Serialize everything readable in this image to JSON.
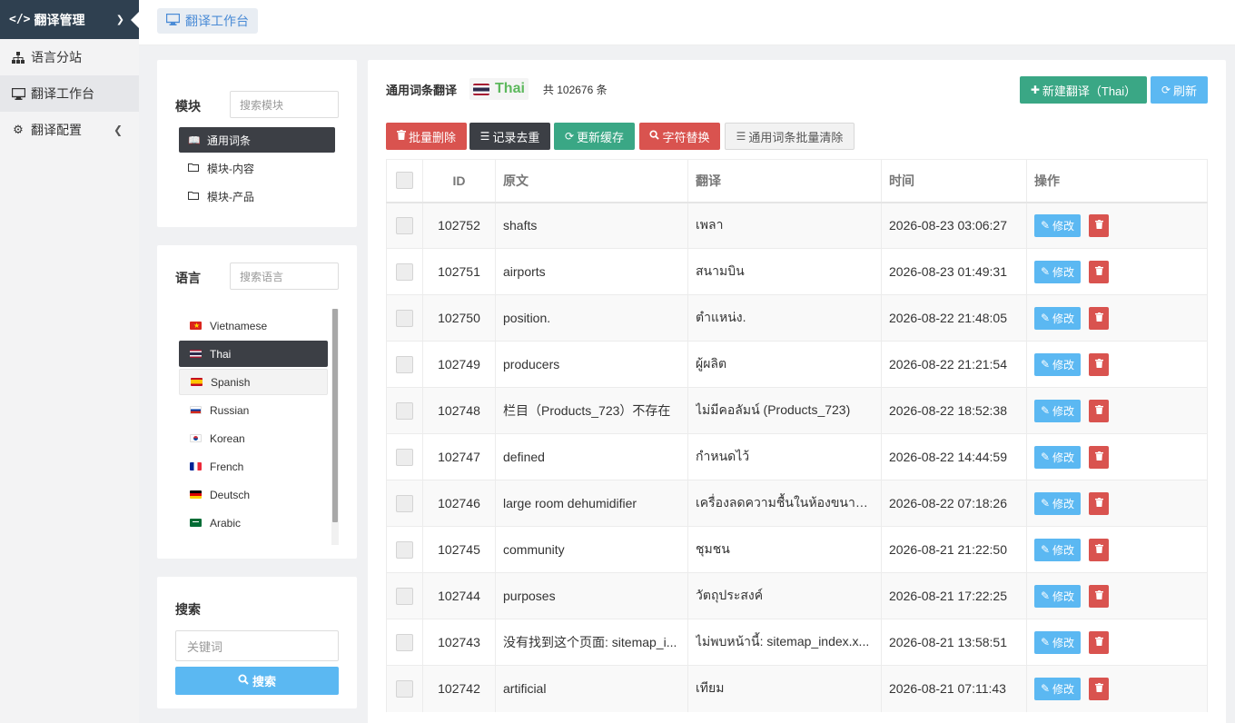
{
  "nav": {
    "header": {
      "code_icon": "</>",
      "title": "翻译管理"
    },
    "items": [
      {
        "label": "语言分站",
        "icon": "sitemap-icon"
      },
      {
        "label": "翻译工作台",
        "icon": "desktop-icon"
      },
      {
        "label": "翻译配置",
        "icon": "gear-icon"
      }
    ]
  },
  "tab": {
    "label": "翻译工作台"
  },
  "module_panel": {
    "title": "模块",
    "search_placeholder": "搜索模块",
    "items": [
      "通用词条",
      "模块-内容",
      "模块-产品"
    ]
  },
  "language_panel": {
    "title": "语言",
    "search_placeholder": "搜索语言",
    "items": [
      "Vietnamese",
      "Thai",
      "Spanish",
      "Russian",
      "Korean",
      "French",
      "Deutsch",
      "Arabic"
    ]
  },
  "search_panel": {
    "title": "搜索",
    "keyword_placeholder": "关键词",
    "button": "搜索"
  },
  "main": {
    "title": "通用词条翻译",
    "language": "Thai",
    "count": "共 102676 条",
    "new_button": "新建翻译（Thai）",
    "refresh_button": "刷新",
    "toolbar": {
      "batch_delete": "批量删除",
      "dedup": "记录去重",
      "update_cache": "更新缓存",
      "replace": "字符替换",
      "batch_clear": "通用词条批量清除"
    },
    "columns": [
      "ID",
      "原文",
      "翻译",
      "时间",
      "操作"
    ],
    "edit_label": "修改",
    "rows": [
      {
        "id": "102752",
        "source": "shafts",
        "translation": "เพลา",
        "time": "2026-08-23 03:06:27"
      },
      {
        "id": "102751",
        "source": "airports",
        "translation": "สนามบิน",
        "time": "2026-08-23 01:49:31"
      },
      {
        "id": "102750",
        "source": "position.",
        "translation": "ตำแหน่ง.",
        "time": "2026-08-22 21:48:05"
      },
      {
        "id": "102749",
        "source": "producers",
        "translation": "ผู้ผลิต",
        "time": "2026-08-22 21:21:54"
      },
      {
        "id": "102748",
        "source": "栏目（Products_723）不存在",
        "translation": "ไม่มีคอลัมน์ (Products_723)",
        "time": "2026-08-22 18:52:38"
      },
      {
        "id": "102747",
        "source": "defined",
        "translation": "กำหนดไว้",
        "time": "2026-08-22 14:44:59"
      },
      {
        "id": "102746",
        "source": "large room dehumidifier",
        "translation": "เครื่องลดความชื้นในห้องขนาดใ...",
        "time": "2026-08-22 07:18:26"
      },
      {
        "id": "102745",
        "source": "community",
        "translation": "ชุมชน",
        "time": "2026-08-21 21:22:50"
      },
      {
        "id": "102744",
        "source": "purposes",
        "translation": "วัตถุประสงค์",
        "time": "2026-08-21 17:22:25"
      },
      {
        "id": "102743",
        "source": "没有找到这个页面: sitemap_i...",
        "translation": "ไม่พบหน้านี้: sitemap_index.x...",
        "time": "2026-08-21 13:58:51"
      },
      {
        "id": "102742",
        "source": "artificial",
        "translation": "เทียม",
        "time": "2026-08-21 07:11:43"
      }
    ]
  },
  "colors": {
    "nav_header": "#2f4050",
    "active_dark": "#3c3f45",
    "primary_blue": "#5bb8f2",
    "success_green": "#3aa785",
    "danger_red": "#d9534f",
    "thai_label_green": "#5cb85c"
  }
}
